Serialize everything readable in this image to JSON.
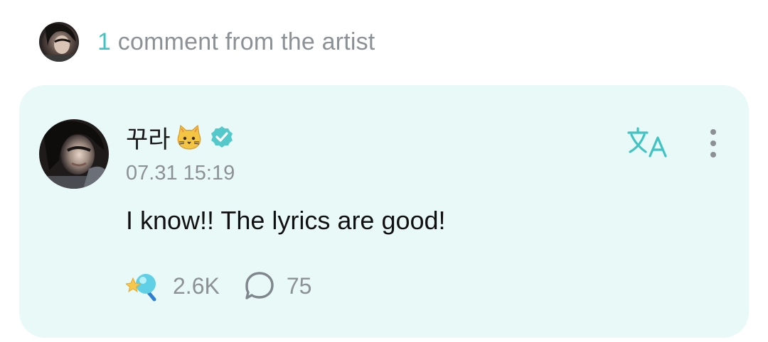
{
  "header": {
    "count": "1",
    "label": " comment from the artist",
    "avatar_icon": "artist-avatar"
  },
  "comment": {
    "author": "꾸라",
    "author_emoji": "cat-face-icon",
    "verified_icon": "verified-badge-icon",
    "timestamp": "07.31 15:19",
    "text": "I know!! The lyrics are good!",
    "translate_icon": "translate-icon",
    "more_icon": "more-vertical-icon",
    "reactions": {
      "icon": "reaction-star-icon",
      "count": "2.6K"
    },
    "replies": {
      "icon": "speech-bubble-icon",
      "count": "75"
    }
  },
  "colors": {
    "accent": "#3fc3c3",
    "card_bg": "#e8f9f7",
    "muted_text": "#8c9196",
    "body_text": "#111111"
  }
}
